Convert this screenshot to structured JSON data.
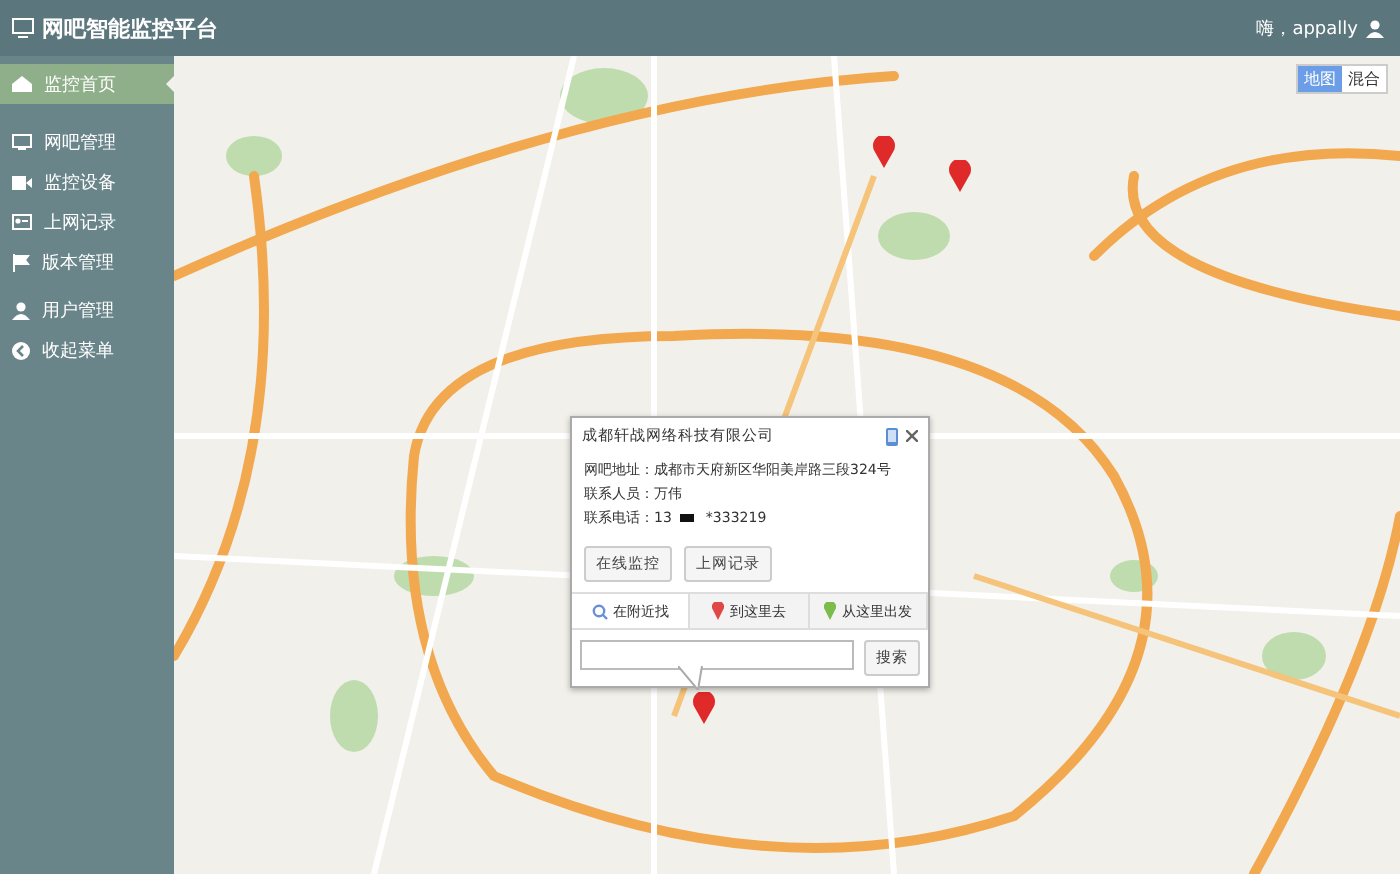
{
  "header": {
    "title": "网吧智能监控平台",
    "greeting": "嗨，appally"
  },
  "sidebar": {
    "items": [
      {
        "label": "监控首页",
        "selected": true
      },
      {
        "label": "网吧管理",
        "selected": false
      },
      {
        "label": "监控设备",
        "selected": false
      },
      {
        "label": "上网记录",
        "selected": false
      },
      {
        "label": "版本管理",
        "selected": false
      },
      {
        "label": "用户管理",
        "selected": false
      },
      {
        "label": "收起菜单",
        "selected": false
      }
    ]
  },
  "map_type": [
    {
      "label": "地图",
      "selected": true
    },
    {
      "label": "混合",
      "selected": false
    }
  ],
  "popup": {
    "title": "成都轩战网络科技有限公司",
    "fields": [
      {
        "label": "网吧地址：",
        "value": "成都市天府新区华阳美岸路三段324号"
      },
      {
        "label": "联系人员：",
        "value": "万伟"
      },
      {
        "label": "联系电话：",
        "value": "13",
        "value_end": "*333219"
      }
    ],
    "buttons": [
      "在线监控",
      "上网记录"
    ],
    "tabs": [
      {
        "label": "在附近找",
        "selected": true
      },
      {
        "label": "到这里去",
        "selected": false
      },
      {
        "label": "从这里出发",
        "selected": false
      }
    ],
    "search_button": "搜索"
  }
}
